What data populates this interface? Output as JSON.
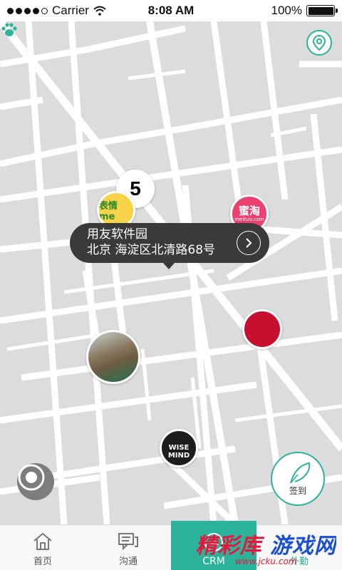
{
  "status_bar": {
    "carrier": "Carrier",
    "time": "8:08 AM",
    "battery": "100%"
  },
  "info_bubble": {
    "title": "用友软件园",
    "address": "北京 海淀区北清路68号"
  },
  "pins": {
    "top": {
      "label": "5"
    },
    "emoji": {
      "label": "表情me"
    },
    "meituo": {
      "label": "蜜淘",
      "sub": "meituo.com"
    },
    "wisemind": {
      "line1": "WISE",
      "line2": "MIND"
    }
  },
  "checkin": {
    "label": "签到"
  },
  "tabs": [
    {
      "label": "首页",
      "icon": "home-icon"
    },
    {
      "label": "沟通",
      "icon": "chat-icon"
    },
    {
      "label": "CRM",
      "icon": "crm-icon"
    },
    {
      "label": "外勤",
      "icon": "field-icon"
    }
  ],
  "watermark": {
    "main": "精彩库 游戏网",
    "sub": "www.jcku.com"
  },
  "colors": {
    "accent": "#2bb39b",
    "bubble": "#3a3a3a",
    "map_bg": "#dcdcdc"
  }
}
